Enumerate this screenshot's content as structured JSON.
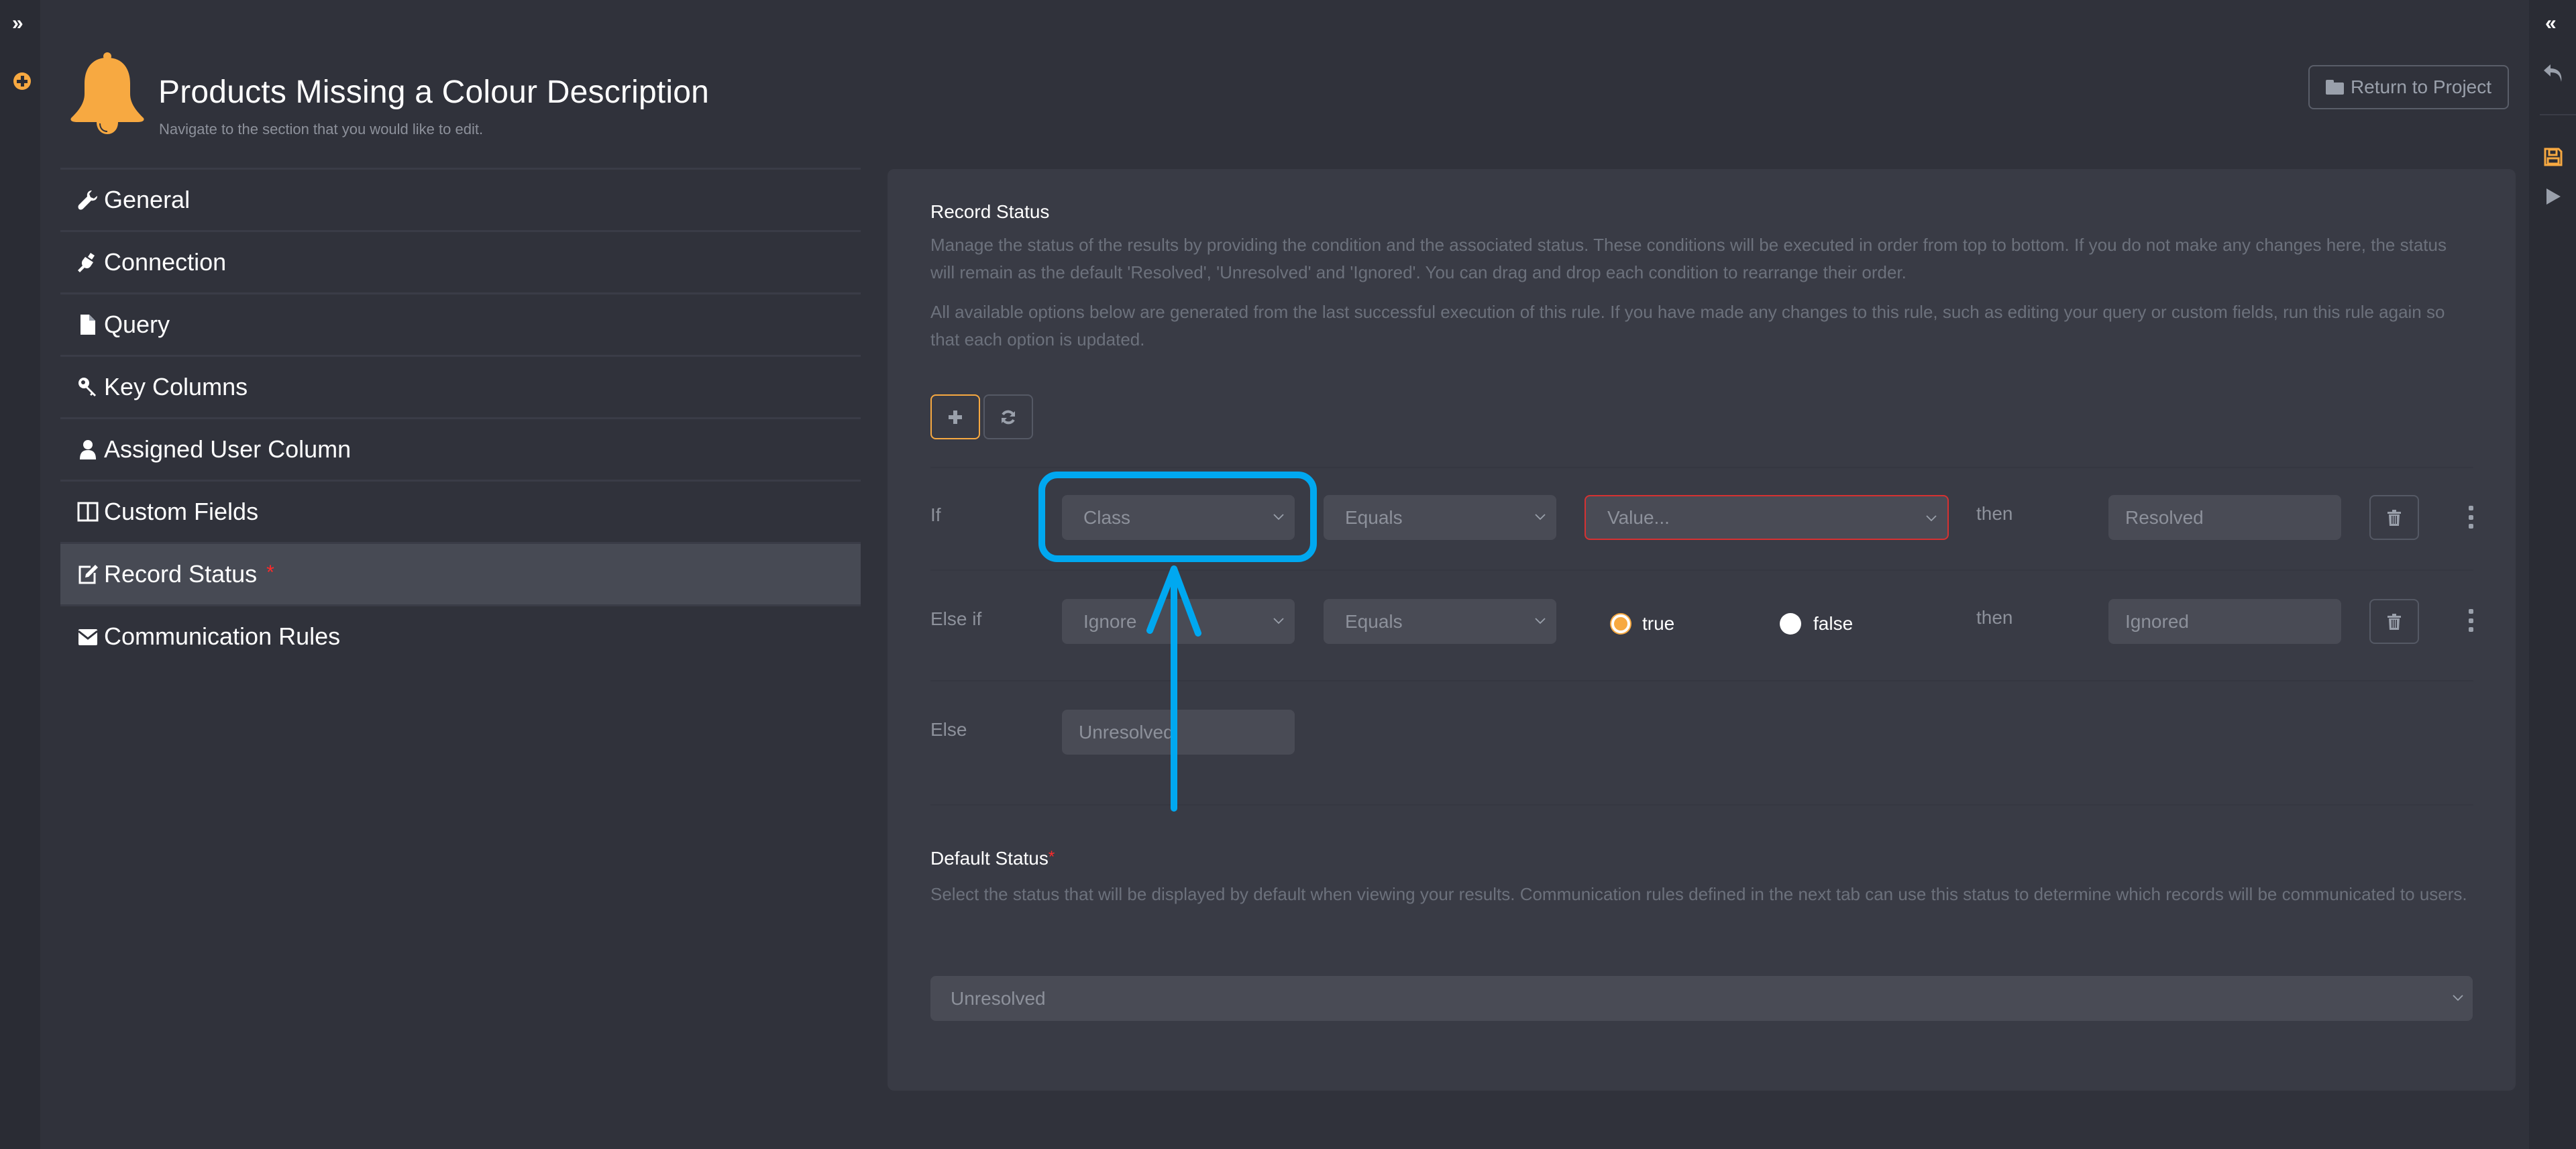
{
  "left_rail": {
    "expand_icon": "double-chevron-right-icon",
    "add_icon": "plus-circle-icon"
  },
  "right_rail": {
    "collapse_icon": "double-chevron-left-icon",
    "undo_icon": "undo-icon",
    "save_icon": "save-icon",
    "run_icon": "play-icon"
  },
  "header": {
    "icon": "bell-icon",
    "title": "Products Missing a Colour Description",
    "subtitle": "Navigate to the section that you would like to edit.",
    "return_button": "Return to Project"
  },
  "nav": {
    "items": [
      {
        "label": "General",
        "icon": "wrench-icon"
      },
      {
        "label": "Connection",
        "icon": "plug-icon"
      },
      {
        "label": "Query",
        "icon": "file-icon"
      },
      {
        "label": "Key Columns",
        "icon": "key-icon"
      },
      {
        "label": "Assigned User Column",
        "icon": "user-icon"
      },
      {
        "label": "Custom Fields",
        "icon": "columns-icon"
      },
      {
        "label": "Record Status",
        "icon": "edit-icon",
        "required": "*",
        "active": true
      },
      {
        "label": "Communication Rules",
        "icon": "envelope-icon"
      }
    ]
  },
  "record_status": {
    "title": "Record Status",
    "description_1": "Manage the status of the results by providing the condition and the associated status. These conditions will be executed in order from top to bottom. If you do not make any changes here, the status will remain as the default 'Resolved', 'Unresolved' and 'Ignored'. You can drag and drop each condition to rearrange their order.",
    "description_2": "All available options below are generated from the last successful execution of this rule. If you have made any changes to this rule, such as editing your query or custom fields, run this rule again so that each option is updated.",
    "add_button_icon": "plus-icon",
    "refresh_button_icon": "refresh-icon",
    "conditions": [
      {
        "label": "If",
        "field": "Class",
        "operator": "Equals",
        "value_placeholder": "Value...",
        "then": "then",
        "status": "Resolved"
      },
      {
        "label": "Else if",
        "field": "Ignore",
        "operator": "Equals",
        "radio_true": "true",
        "radio_false": "false",
        "selected": "true",
        "then": "then",
        "status": "Ignored"
      }
    ],
    "else": {
      "label": "Else",
      "status": "Unresolved"
    }
  },
  "default_status": {
    "label": "Default Status",
    "required": "*",
    "description": "Select the status that will be displayed by default when viewing your results. Communication rules defined in the next tab can use this status to determine which records will be communicated to users.",
    "value": "Unresolved"
  },
  "colors": {
    "accent": "#f7a941",
    "annotation": "#00a8f0",
    "error": "#d63232",
    "required": "#ff2a2a"
  }
}
